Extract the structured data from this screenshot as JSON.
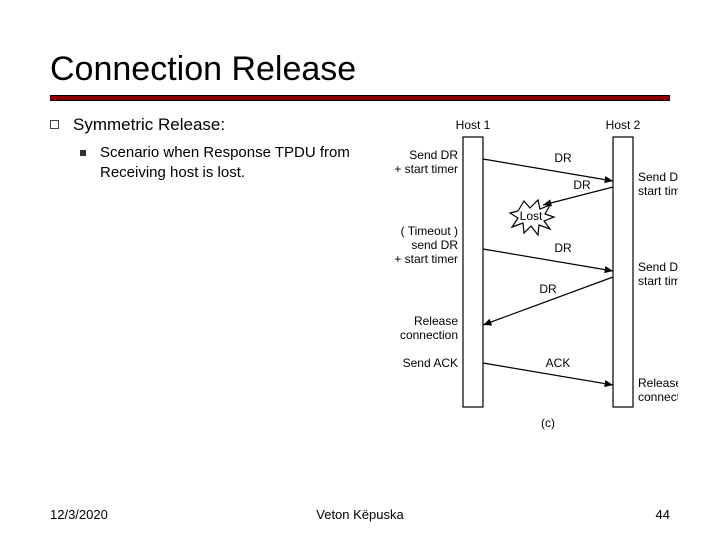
{
  "title": "Connection Release",
  "bullet1": "Symmetric Release:",
  "bullet2": "Scenario when Response TPDU from Receiving host is lost.",
  "diagram": {
    "host1": "Host 1",
    "host2": "Host 2",
    "h1_send_dr1a": "Send DR",
    "h1_send_dr1b": "+ start timer",
    "h1_timeout1": "( Timeout )",
    "h1_timeout2a": "send DR",
    "h1_timeout2b": "+ start timer",
    "h1_release1": "Release",
    "h1_release2": "connection",
    "h1_ack": "Send ACK",
    "h2_send_dr1a": "Send DR &",
    "h2_send_dr1b": "start timer",
    "h2_send_dr2a": "Send DR &",
    "h2_send_dr2b": "start timer",
    "h2_release1": "Release",
    "h2_release2": "connection",
    "lost": "Lost",
    "dr": "DR",
    "ack": "ACK",
    "caption": "(c)"
  },
  "footer": {
    "date": "12/3/2020",
    "author": "Veton Këpuska",
    "page": "44"
  }
}
